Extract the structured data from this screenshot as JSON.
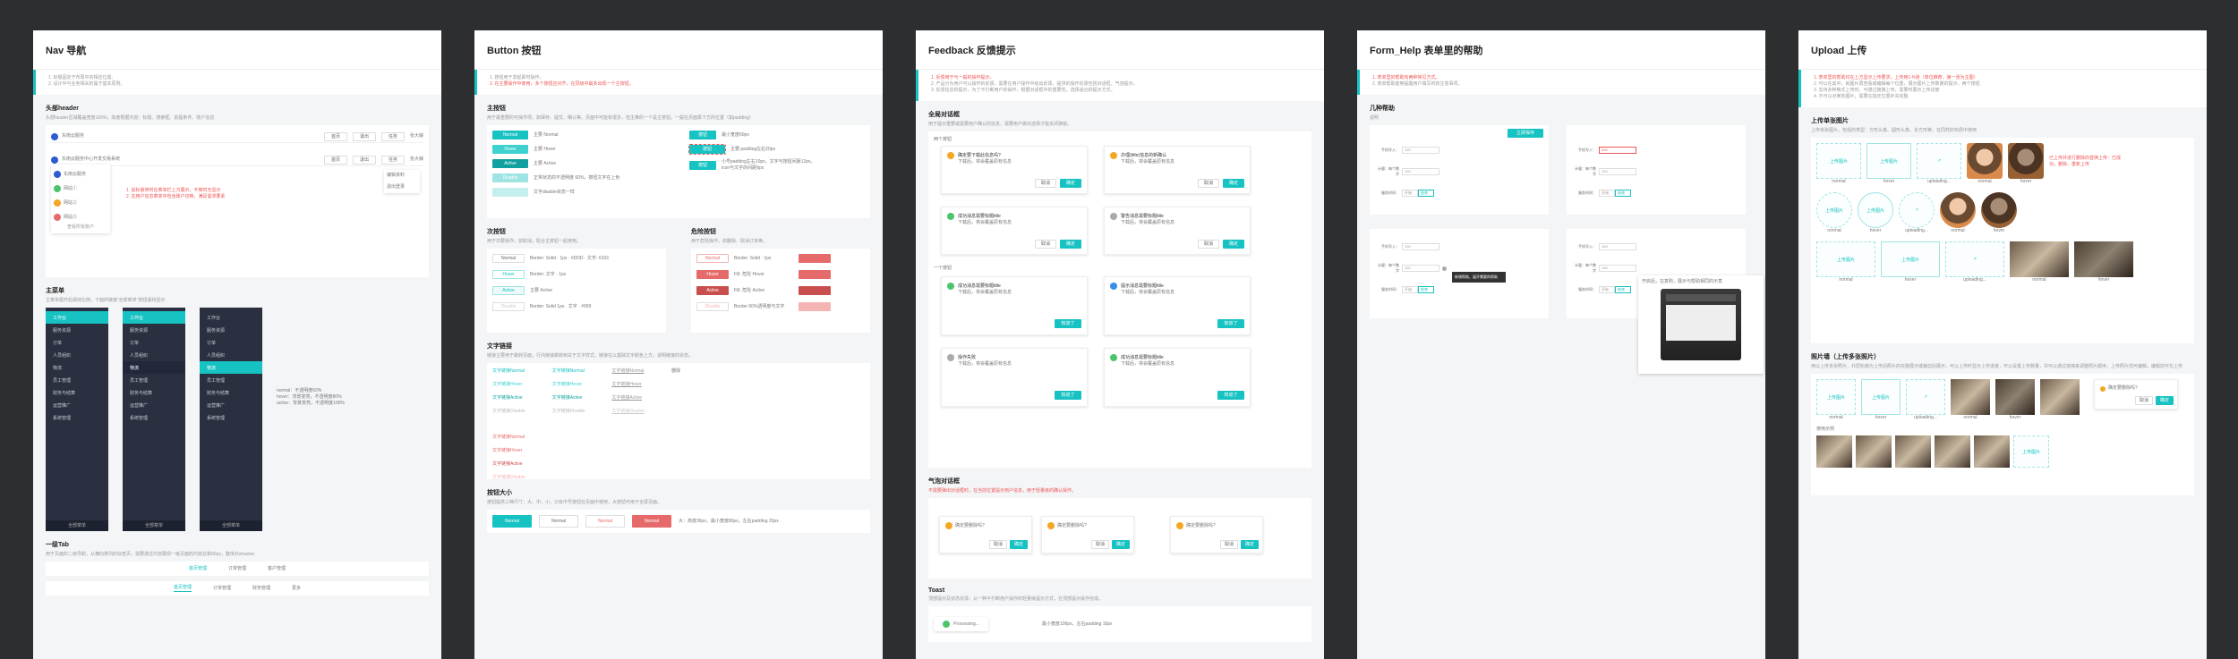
{
  "boards": {
    "nav": {
      "title": "Nav 导航",
      "notes": [
        "1. 标题固定于布局中的相应位置。",
        "2. 设计中与业务相关的属于基本原则。"
      ],
      "header": {
        "title": "头部header",
        "desc": "头部header区域覆盖宽度100%，高度根据内容：标题、搜索框、前提条件、账户信息",
        "brand1": "东南云服务",
        "brand2": "东南云服务中心开发交易系统",
        "btns": [
          "首页",
          "退出",
          "任务"
        ],
        "user": "张大娘",
        "popover": [
          "编辑资料",
          "退出登录"
        ],
        "accounts": [
          "东南云服务",
          "网站①",
          "网站②",
          "网站③"
        ],
        "more_label": "查看所有账户",
        "red_notes": [
          "1. 鼠标悬停时在菜单栏上方展示，不够时无显示",
          "2. 在用户信息菜单中包含账户切换，满足需求要素"
        ]
      },
      "menu": {
        "title": "主菜单",
        "desc": "主菜单展开后保持左侧，下面的链接“全部菜单”按钮保持显示",
        "items": [
          "工作台",
          "服务资源",
          "订单",
          "人员组织",
          "物流",
          "员工管理",
          "财务与结算",
          "运营推广",
          "系统管理"
        ],
        "footer": "全部菜单",
        "legend": [
          "normal：不透明度60%",
          "hover：背景变亮，不透明度80%",
          "active：背景变亮，不透明度100%"
        ]
      },
      "tabs": {
        "title": "一级Tab",
        "desc": "用于页面的二级导航，从横向排列的标签页，需要通过内容展现一级页面的内容总和90px，整体外shadow",
        "row1": [
          "首页管理",
          "订单管理",
          "客户管理"
        ],
        "row2": [
          "首页管理",
          "订单管理",
          "财务管理",
          "更多"
        ]
      }
    },
    "button": {
      "title": "Button 按钮",
      "notes": [
        "1. 按钮用于发起即时操作。",
        "2. 在主要操作中使用，多个按钮应对齐，在同级中最多出现一个主按钮。"
      ],
      "primary": {
        "title": "主按钮",
        "desc": "用于最重要的可操作项，如保存、提交、确认等。页面中可能有很多，但主推的一个是主按钮。一般在页面靠下方的位置（如padding）",
        "states": [
          "Normal",
          "Hover",
          "Active",
          "Disable"
        ],
        "labels": [
          "主要 Normal",
          "主要 Hover",
          "主要 Active",
          "正常状态的不透明度 60%，按钮文字在上色",
          "文字disable状态一样"
        ],
        "small_btn": "按钮",
        "small_notes": [
          "最小宽度60px",
          "主要 padding左右20px",
          "小号padding左右10px，文字与按钮间距12px，icon与文字的间距8px"
        ]
      },
      "secondary": {
        "title": "次按钮",
        "desc": "用于次要操作，如取消，配合主按钮一起使用。",
        "states": [
          "Normal",
          "Hover",
          "Active",
          "Disable"
        ],
        "labels": [
          "Border: Solid · 1px · #DDD · 文字: #333",
          "Border: 文字 · 1px",
          "主要 Active",
          "Border: Solid 1px · 文字 · #999"
        ]
      },
      "danger": {
        "title": "危险按钮",
        "desc": "用于危险操作，如删除、取消订单等。",
        "states": [
          "Normal",
          "Hover",
          "Active",
          "Disable"
        ],
        "labels": [
          "Border: Solid · 1px",
          "Fill: 危险 Hover",
          "Fill: 危险 Active",
          "Border 60%透明度与文字"
        ]
      },
      "text_link": {
        "title": "文字链接",
        "desc": "链接主要用于跳转页面，行内链接跳转到关于文字样式，链接在以基础文字颜色上方，说明链接的状态。",
        "states": [
          "文字链接Normal",
          "文字链接Hover",
          "文字链接Active",
          "文字链接Disable"
        ],
        "red_states": [
          "文字链接Normal",
          "文字链接Hover",
          "文字链接Active",
          "文字链接Disable"
        ],
        "tag": "删除"
      },
      "size": {
        "title": "按钮大小",
        "desc": "按钮提供三种尺寸：大、中、小。只有中号按钮在页面中使用，大按钮可用于全屏页面。",
        "labels": [
          "Normal",
          "Normal",
          "Normal",
          "Normal"
        ],
        "note": "大：高度36px，最小宽度80px，左右padding 20px"
      }
    },
    "feedback": {
      "title": "Feedback 反馈提示",
      "notes": [
        "1. 反馈用于与一般的操作提示。",
        "2. 产品分为用户可以操作的反馈，需要在用户操作中给出反馈，提供的操作反馈包括对话框、气泡提示。",
        "3. 反馈信息的提示，为了不打断用户的操作，根据对话框中的重要性，选择适合的提示方式。"
      ],
      "modal": {
        "title": "全局对话框",
        "desc": "用于提示重要或需要用户确认的信息，需要用户做出选择才能关闭弹窗。",
        "sub_type1": "两个按钮",
        "sub_type2": "一个按钮",
        "dialogs": [
          {
            "title": "确定要下载此信息吗?",
            "body": "下载后，将会覆盖原有信息"
          },
          {
            "title": "办理(title)信息的新确认",
            "body": "下载后，将会覆盖原有信息"
          },
          {
            "title": "成功消息需要标题title",
            "body": "下载后，将会覆盖原有信息"
          },
          {
            "title": "警告消息需要标题title",
            "body": "下载后，将会覆盖原有信息"
          },
          {
            "title": "成功消息需要标题title",
            "body": "下载后，将会覆盖原有信息"
          },
          {
            "title": "提示消息需要标题title",
            "body": "下载后，将会覆盖原有信息"
          },
          {
            "title": "操作失败",
            "body": "下载后，将会覆盖原有信息"
          },
          {
            "title": "成功消息需要标题title",
            "body": "下载后，将会覆盖原有信息"
          }
        ],
        "cancel": "取消",
        "ok": "确定",
        "know": "知道了"
      },
      "popconfirm": {
        "title": "气泡对话框",
        "desc": "不需要弹出对话框时，在当前位置提示用户信息，用于轻量级的确认操作。",
        "items": [
          "确定要删除吗?",
          "确定要删除吗?",
          "确定要删除吗?"
        ],
        "cancel": "取消",
        "ok": "确定"
      },
      "toast": {
        "title": "Toast",
        "desc": "顶部提示及状态反馈：从一种不打断用户操作的轻量级提示方式，在顶部提示操作完成。",
        "item": "Processing...",
        "note": "最小宽度100px，左右padding 10px"
      }
    },
    "form": {
      "title": "Form_Help 表单里的帮助",
      "notes": [
        "1. 表单里的帮助有两种常见方式。",
        "2. 表单帮助能够提醒用户填写时的注意事项。"
      ],
      "types": {
        "title": "几种帮助",
        "desc": "说明",
        "btn": "立即保存",
        "fields": [
          "手机号入：",
          "计量：每个数字",
          "服务时间："
        ],
        "values": [
          "100",
          "100",
          "开始"
        ],
        "error_value": "200",
        "tooltip": "新增帮助，展开需要的帮助",
        "popover_title": "开启后，在复购，展示与帮助相同的示意",
        "toggle": [
          "开始",
          "结束"
        ]
      }
    },
    "upload": {
      "title": "Upload 上传",
      "notes": [
        "1. 表单里的帮助均在上方显示上传要求，上传用1-N张（单位推荐，第一张为主图）",
        "2. 可以在其中，就图片再查看或编辑每个位置，展示图片上传数量的提示，两个按钮",
        "3. 支持多种格式上传时，可通过拖拽上传，需要时展示上传进度",
        "4. 不可以对某些图片，需要在指定位置补充完整"
      ],
      "single": {
        "title": "上传单张图片",
        "desc": "上传单张图片，包括的类型：方形头像、圆形头像、长方形等，在同样的布局中使用",
        "status": [
          "normal",
          "hover",
          "uploading...",
          "normal",
          "hover"
        ],
        "box_label": "上传图片",
        "red_note": "已上传并进行删除的替换上传：已成功，删除、重新上传"
      },
      "multi": {
        "title": "照片墙（上传多张照片）",
        "desc": "用以上传多张照片，外层轮廓为上传后照片的完整展示或裁剪后展示，可以上传时显示上传进度，可以设置上传数量，并可以通过拖拽来调整照片顺序，上传照片前可编辑，编辑前可先上传",
        "status": [
          "normal",
          "hover",
          "uploading...",
          "normal",
          "hover"
        ],
        "box_label": "上传图片",
        "confirm": "确定要删除吗?",
        "cancel": "取消",
        "ok": "确定",
        "example_label": "使用示例"
      }
    }
  },
  "colors": {
    "brand": "#16c2c2",
    "danger": "#e76a6a",
    "warning": "#f5a623",
    "success": "#4cc46b",
    "info": "#3a8ee6",
    "menu_dark": "#2b3040"
  }
}
